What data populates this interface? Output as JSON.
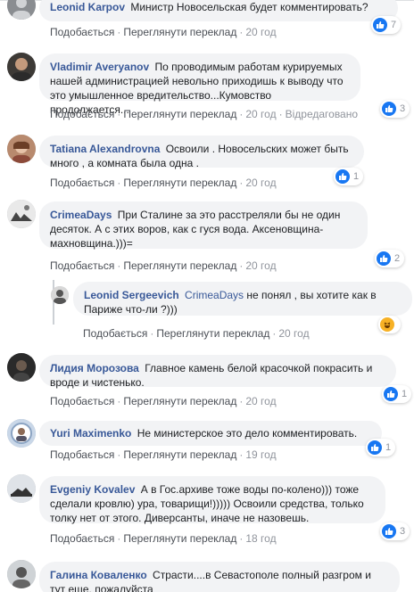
{
  "actions": {
    "like": "Подобається",
    "translate": "Переглянути переклад",
    "edited": "Відредаговано"
  },
  "comments": [
    {
      "author": "Leonid Karpov",
      "text": "Министр Новосельская будет комментировать?",
      "time": "20 год",
      "reactions": "7"
    },
    {
      "author": "Vladimir Averyanov",
      "text": "По проводимым работам курируемых нашей администрацией невольно приходишь к выводу что это умышленное вредительство...Кумовство продолжается...",
      "time": "20 год",
      "reactions": "3"
    },
    {
      "author": "Tatiana Alexandrovna",
      "text": "Освоили . Новосельских может быть много , а комната была одна .",
      "time": "20 год",
      "reactions": "1"
    },
    {
      "author": "CrimeaDays",
      "text": "При Сталине за это расстреляли бы не один десяток. А с этих воров, как с гуся вода. Аксеновщина-махновщина.)))=",
      "time": "20 год",
      "reactions": "2"
    },
    {
      "author": "Leonid Sergeevich",
      "mention": "CrimeaDays",
      "text": "не понял , вы хотите как в Париже что-ли ?)))",
      "time": "20 год",
      "reactions": ""
    },
    {
      "author": "Лидия Морозова",
      "text": "Главное камень белой красочкой покрасить и вроде и чистенько.",
      "time": "20 год",
      "reactions": "1"
    },
    {
      "author": "Yuri Maximenko",
      "text": "Не министерское это дело комментировать.",
      "time": "19 год",
      "reactions": "1"
    },
    {
      "author": "Evgeniy Kovalev",
      "text": "А в Гос.архиве тоже воды по-колено))) тоже сделали кровлю) ура, товарищи!))))) Освоили средства, только толку нет от этого. Диверсанты, иначе не назовешь.",
      "time": "18 год",
      "reactions": "3"
    },
    {
      "author": "Галина Коваленко",
      "text": "Страсти....в Севастополе полный разгром и тут еще, пожалуйста",
      "time": "",
      "reactions": ""
    }
  ],
  "colors": {
    "author": "#385898",
    "bubble": "#f2f3f5",
    "like": "#1877f2",
    "haha": "#f7b125",
    "meta": "#90949c"
  }
}
